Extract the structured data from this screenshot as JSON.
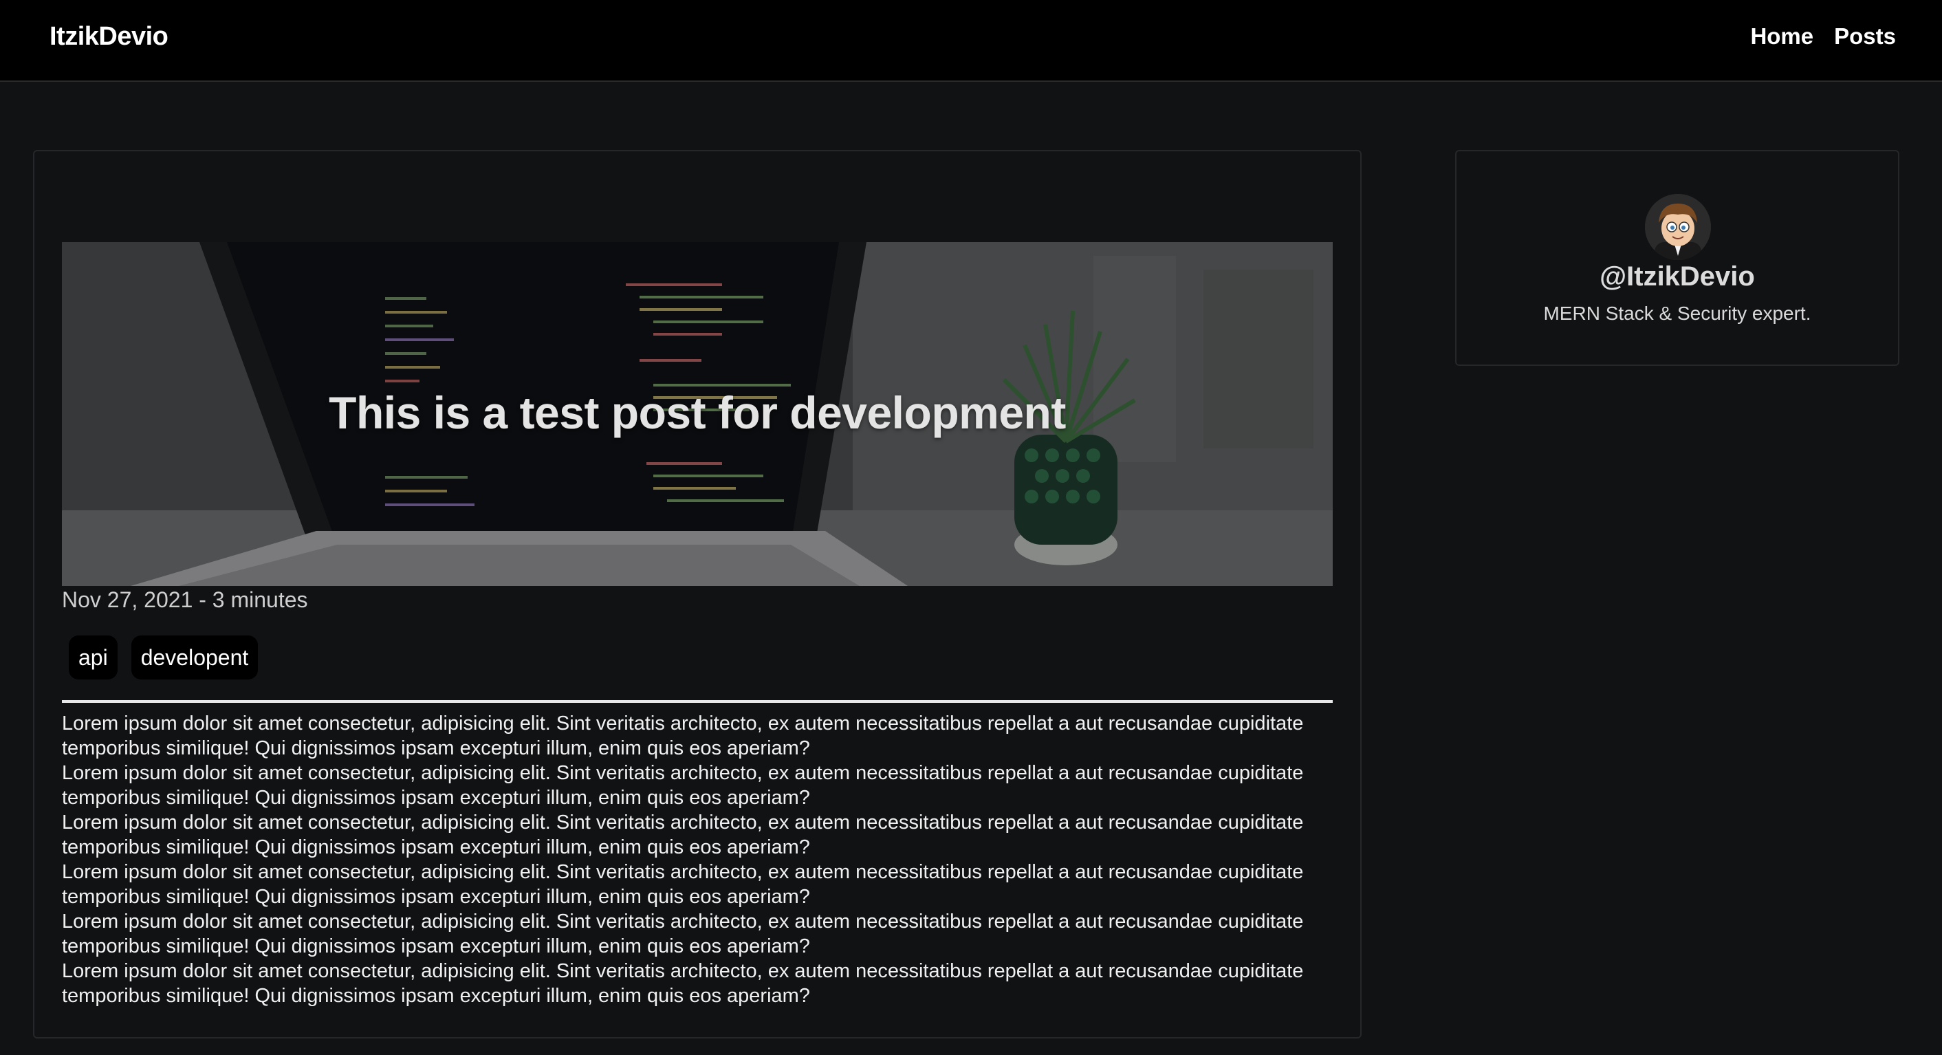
{
  "navbar": {
    "brand": "ItzikDevio",
    "links": [
      {
        "label": "Home"
      },
      {
        "label": "Posts"
      }
    ]
  },
  "post": {
    "title": "This is a test post for development",
    "meta": "Nov 27, 2021 - 3 minutes",
    "tags": [
      "api",
      "developent"
    ],
    "paragraphs": [
      "Lorem ipsum dolor sit amet consectetur, adipisicing elit. Sint veritatis architecto, ex autem necessitatibus repellat a aut recusandae cupiditate temporibus similique! Qui dignissimos ipsam excepturi illum, enim quis eos aperiam?",
      "Lorem ipsum dolor sit amet consectetur, adipisicing elit. Sint veritatis architecto, ex autem necessitatibus repellat a aut recusandae cupiditate temporibus similique! Qui dignissimos ipsam excepturi illum, enim quis eos aperiam?",
      "Lorem ipsum dolor sit amet consectetur, adipisicing elit. Sint veritatis architecto, ex autem necessitatibus repellat a aut recusandae cupiditate temporibus similique! Qui dignissimos ipsam excepturi illum, enim quis eos aperiam?",
      "Lorem ipsum dolor sit amet consectetur, adipisicing elit. Sint veritatis architecto, ex autem necessitatibus repellat a aut recusandae cupiditate temporibus similique! Qui dignissimos ipsam excepturi illum, enim quis eos aperiam?",
      "Lorem ipsum dolor sit amet consectetur, adipisicing elit. Sint veritatis architecto, ex autem necessitatibus repellat a aut recusandae cupiditate temporibus similique! Qui dignissimos ipsam excepturi illum, enim quis eos aperiam?",
      "Lorem ipsum dolor sit amet consectetur, adipisicing elit. Sint veritatis architecto, ex autem necessitatibus repellat a aut recusandae cupiditate temporibus similique! Qui dignissimos ipsam excepturi illum, enim quis eos aperiam?"
    ]
  },
  "profile": {
    "handle": "@ItzikDevio",
    "bio": "MERN Stack & Security expert."
  },
  "colors": {
    "background": "#111214",
    "navbar": "#000000",
    "tag_background": "#000000",
    "card_border": "#26272b"
  }
}
